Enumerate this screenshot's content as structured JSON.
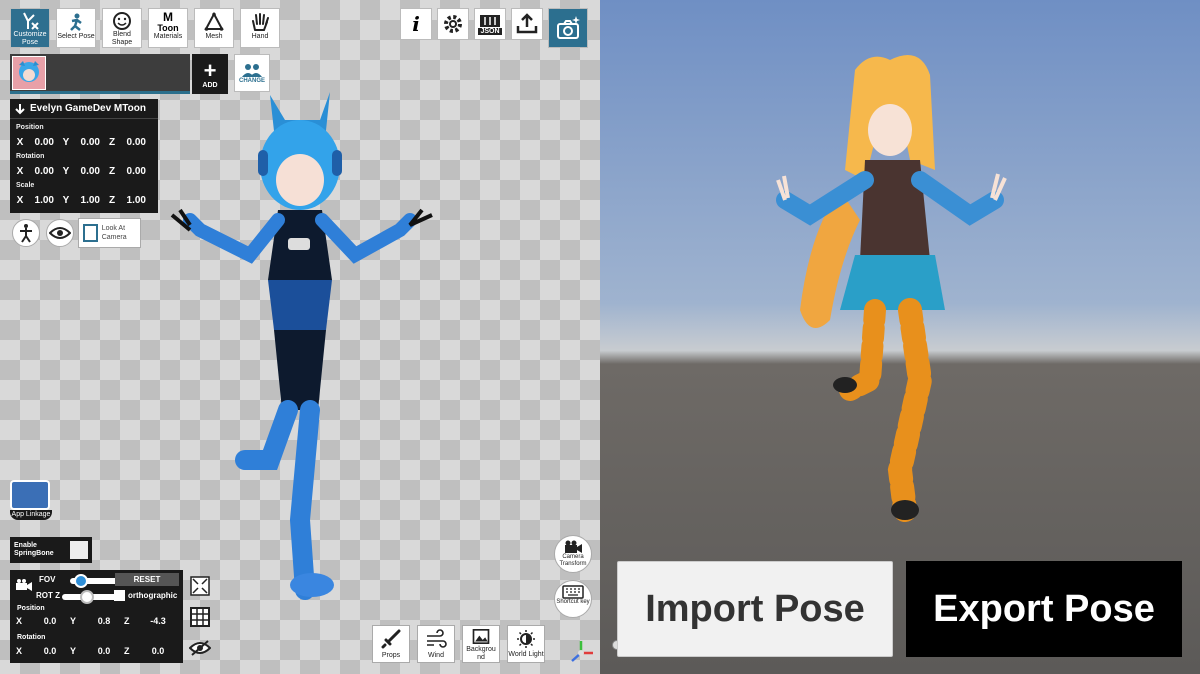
{
  "toolbar": {
    "customize_pose": "Customize Pose",
    "select_pose": "Select Pose",
    "blend_shape": "Blend Shape",
    "materials_top": "M",
    "materials_mid": "Toon",
    "materials": "Materials",
    "mesh": "Mesh",
    "hand": "Hand",
    "info": "i",
    "json": "JSON"
  },
  "avatar": {
    "add": "ADD",
    "change": "CHANGE"
  },
  "transform": {
    "name": "Evelyn GameDev MToon",
    "position_label": "Position",
    "rotation_label": "Rotation",
    "scale_label": "Scale",
    "x": "X",
    "y": "Y",
    "z": "Z",
    "position": [
      "0.00",
      "0.00",
      "0.00"
    ],
    "rotation": [
      "0.00",
      "0.00",
      "0.00"
    ],
    "scale": [
      "1.00",
      "1.00",
      "1.00"
    ],
    "look_at_camera": "Look At Camera"
  },
  "app_linkage": "App Linkage",
  "springbone": "Enable SpringBone",
  "camera": {
    "fov": "FOV",
    "reset": "RESET",
    "rotz": "ROT Z",
    "orthographic": "orthographic",
    "position_label": "Position",
    "rotation_label": "Rotation",
    "position": [
      "0.0",
      "0.8",
      "-4.3"
    ],
    "rotation": [
      "0.0",
      "0.0",
      "0.0"
    ]
  },
  "right_tools": {
    "camera_transform": "Camera Transform",
    "shortcut_key": "Shortcut key"
  },
  "bottom_tools": {
    "props": "Props",
    "wind": "Wind",
    "background": "Backgrou nd",
    "world_light": "World Light"
  },
  "actions": {
    "import": "Import Pose",
    "export": "Export Pose"
  }
}
